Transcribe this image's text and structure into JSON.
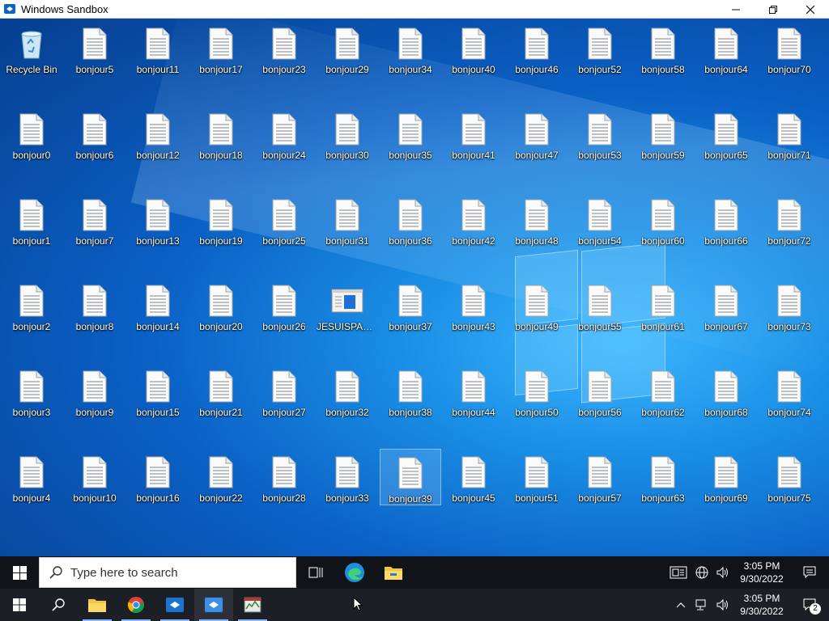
{
  "window": {
    "title": "Windows Sandbox",
    "controls": [
      "minimize",
      "restore",
      "close"
    ]
  },
  "desktop": {
    "recycle_bin": {
      "label": "Recycle Bin",
      "icon": "recycle-bin-icon"
    },
    "columns": [
      [
        "bonjour0",
        "bonjour1",
        "bonjour2",
        "bonjour3",
        "bonjour4"
      ],
      [
        "bonjour5",
        "bonjour6",
        "bonjour7",
        "bonjour8",
        "bonjour9",
        "bonjour10"
      ],
      [
        "bonjour11",
        "bonjour12",
        "bonjour13",
        "bonjour14",
        "bonjour15",
        "bonjour16"
      ],
      [
        "bonjour17",
        "bonjour18",
        "bonjour19",
        "bonjour20",
        "bonjour21",
        "bonjour22"
      ],
      [
        "bonjour23",
        "bonjour24",
        "bonjour25",
        "bonjour26",
        "bonjour27",
        "bonjour28"
      ],
      [
        "bonjour29",
        "bonjour30",
        "bonjour31",
        "JESUISPASU...",
        "bonjour32",
        "bonjour33"
      ],
      [
        "bonjour34",
        "bonjour35",
        "bonjour36",
        "bonjour37",
        "bonjour38",
        "bonjour39"
      ],
      [
        "bonjour40",
        "bonjour41",
        "bonjour42",
        "bonjour43",
        "bonjour44",
        "bonjour45"
      ],
      [
        "bonjour46",
        "bonjour47",
        "bonjour48",
        "bonjour49",
        "bonjour50",
        "bonjour51"
      ],
      [
        "bonjour52",
        "bonjour53",
        "bonjour54",
        "bonjour55",
        "bonjour56",
        "bonjour57"
      ],
      [
        "bonjour58",
        "bonjour59",
        "bonjour60",
        "bonjour61",
        "bonjour62",
        "bonjour63"
      ],
      [
        "bonjour64",
        "bonjour65",
        "bonjour66",
        "bonjour67",
        "bonjour68",
        "bonjour69"
      ],
      [
        "bonjour70",
        "bonjour71",
        "bonjour72",
        "bonjour73",
        "bonjour74",
        "bonjour75"
      ]
    ],
    "special_icon_label": "JESUISPASU...",
    "selected_label": "bonjour39"
  },
  "sandbox_taskbar": {
    "search_placeholder": "Type here to search",
    "apps": [
      "task-view-icon",
      "edge-icon",
      "file-explorer-icon"
    ],
    "time": "3:05 PM",
    "date": "9/30/2022"
  },
  "host_taskbar": {
    "apps": [
      "search-icon",
      "file-explorer-icon",
      "chrome-icon",
      "sandbox-icon",
      "sandbox-icon",
      "task-manager-icon"
    ],
    "time": "3:05 PM",
    "date": "9/30/2022",
    "notification_count": "2"
  },
  "colors": {
    "desktop_dark": "#063f8f",
    "desktop_light": "#3cb6ff",
    "taskbar": "#101418",
    "host_taskbar": "#1c2026"
  }
}
